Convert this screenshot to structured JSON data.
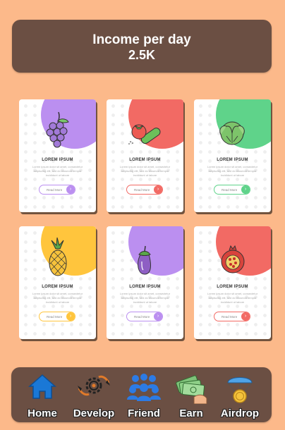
{
  "header": {
    "label": "Income per day",
    "value": "2.5K"
  },
  "cards": [
    {
      "title": "LOREM IPSUM",
      "desc": "Lorem ipsum dolor sit amet, consectetur adipiscing elit, sed do eiusmod tempor incididunt ut labore",
      "button": "Read More",
      "fruit": "grapes-icon",
      "color": "#bb8ff0"
    },
    {
      "title": "LOREM IPSUM",
      "desc": "Lorem ipsum dolor sit amet, consectetur adipiscing elit, sed do eiusmod tempor incididunt ut labore",
      "button": "Read More",
      "fruit": "tomato-cucumber-icon",
      "color": "#f26a64"
    },
    {
      "title": "LOREM IPSUM",
      "desc": "Lorem ipsum dolor sit amet, consectetur adipiscing elit, sed do eiusmod tempor incididunt ut labore",
      "button": "Read More",
      "fruit": "cabbage-icon",
      "color": "#5fd38a"
    },
    {
      "title": "LOREM IPSUM",
      "desc": "Lorem ipsum dolor sit amet, consectetur adipiscing elit, sed do eiusmod tempor incididunt ut labore",
      "button": "Read More",
      "fruit": "pineapple-icon",
      "color": "#ffc53d"
    },
    {
      "title": "LOREM IPSUM",
      "desc": "Lorem ipsum dolor sit amet, consectetur adipiscing elit, sed do eiusmod tempor incididunt ut labore",
      "button": "Read More",
      "fruit": "eggplant-icon",
      "color": "#bb8ff0"
    },
    {
      "title": "LOREM IPSUM",
      "desc": "Lorem ipsum dolor sit amet, consectetur adipiscing elit, sed do eiusmod tempor incididunt ut labore",
      "button": "Read More",
      "fruit": "pomegranate-icon",
      "color": "#f26a64"
    }
  ],
  "nav": [
    {
      "label": "Home",
      "icon": "home-icon"
    },
    {
      "label": "Develop",
      "icon": "develop-gear-icon"
    },
    {
      "label": "Friend",
      "icon": "friends-group-icon"
    },
    {
      "label": "Earn",
      "icon": "money-hand-icon"
    },
    {
      "label": "Airdrop",
      "icon": "coin-parachute-icon"
    }
  ],
  "colors": {
    "background": "#fcb98a",
    "panel": "#6b4f43"
  }
}
